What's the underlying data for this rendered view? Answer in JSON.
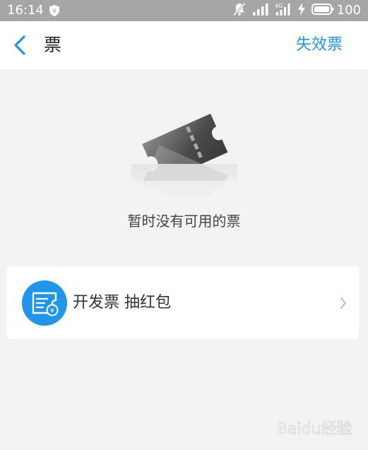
{
  "status_bar": {
    "time": "16:14",
    "battery": "100",
    "network_label": "4G",
    "shield_symbol": "¥",
    "icons": [
      "shield-icon",
      "notification-off-icon",
      "signal-icon",
      "signal-4g-icon",
      "charging-icon",
      "battery-icon"
    ]
  },
  "nav": {
    "back_icon": "chevron-left-icon",
    "title": "票",
    "action": "失效票"
  },
  "empty_state": {
    "icon": "ticket-icon",
    "message": "暂时没有可用的票"
  },
  "invoice_card": {
    "icon": "invoice-icon",
    "label": "开发票 抽红包",
    "icon_symbol": "¥",
    "chevron": "chevron-right-icon"
  },
  "watermark": {
    "text": "Baidu经验"
  },
  "colors": {
    "accent": "#2196e8",
    "status_bar": "#a6a6a6",
    "background": "#f3f3f3"
  }
}
